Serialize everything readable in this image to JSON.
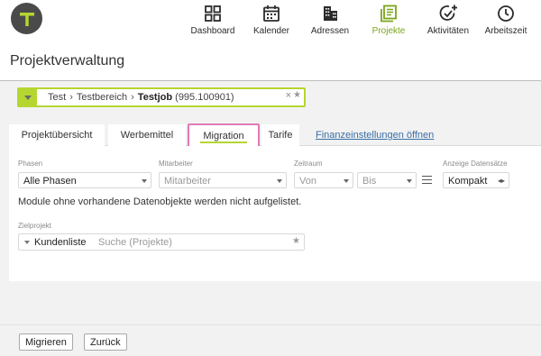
{
  "header": {
    "nav": [
      {
        "label": "Dashboard",
        "icon": "dashboard-icon"
      },
      {
        "label": "Kalender",
        "icon": "calendar-icon"
      },
      {
        "label": "Adressen",
        "icon": "buildings-icon"
      },
      {
        "label": "Projekte",
        "icon": "projects-icon"
      },
      {
        "label": "Aktivitäten",
        "icon": "activity-add-icon"
      },
      {
        "label": "Arbeitszeit",
        "icon": "clock-icon"
      }
    ],
    "active_nav": "Projekte"
  },
  "page": {
    "title": "Projektverwaltung"
  },
  "job": {
    "crumb1": "Test",
    "crumb2": "Testbereich",
    "name": "Testjob",
    "number": "(995.100901)",
    "sep": "›",
    "clear": "×",
    "star": "★"
  },
  "tabs": {
    "items": [
      "Projektübersicht",
      "Werbemittel",
      "Migration",
      "Tarife"
    ],
    "link": "Finanzeinstellungen öffnen",
    "active": "Migration"
  },
  "filters": {
    "phasen_label": "Phasen",
    "phasen_value": "Alle Phasen",
    "mitarbeiter_label": "Mitarbeiter",
    "mitarbeiter_placeholder": "Mitarbeiter",
    "zeitraum_label": "Zeitraum",
    "von": "Von",
    "bis": "Bis",
    "anzeige_label": "Anzeige Datensätze",
    "anzeige_value": "Kompakt"
  },
  "info_text": "Module ohne vorhandene Datenobjekte werden nicht aufgelistet.",
  "zielprojekt": {
    "label": "Zielprojekt",
    "value": "Kundenliste",
    "placeholder": "Suche (Projekte)",
    "star": "★"
  },
  "footer": {
    "migrate": "Migrieren",
    "back": "Zurück"
  },
  "colors": {
    "accent": "#b5d631",
    "active_nav": "#7aa51a",
    "highlight": "#e07ab5",
    "link": "#3a6ea5"
  }
}
